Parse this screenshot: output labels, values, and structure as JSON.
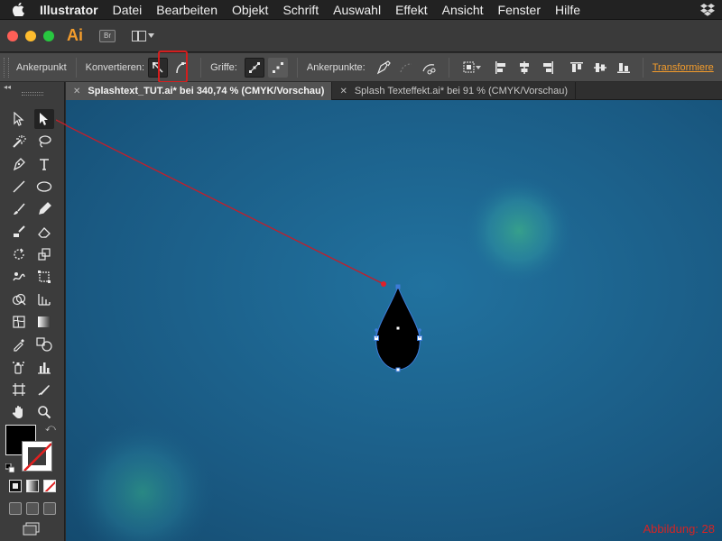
{
  "menubar": {
    "app": "Illustrator",
    "items": [
      "Datei",
      "Bearbeiten",
      "Objekt",
      "Schrift",
      "Auswahl",
      "Effekt",
      "Ansicht",
      "Fenster",
      "Hilfe"
    ]
  },
  "appbar": {
    "logo": "Ai",
    "bridge_label": "Br"
  },
  "controlbar": {
    "context_label": "Ankerpunkt",
    "convert_label": "Konvertieren:",
    "handles_label": "Griffe:",
    "anchors_label": "Ankerpunkte:",
    "transform_link": "Transformiere"
  },
  "tabs": [
    {
      "label": "Splashtext_TUT.ai* bei 340,74 % (CMYK/Vorschau)",
      "active": true
    },
    {
      "label": "Splash Texteffekt.ai* bei 91 % (CMYK/Vorschau)",
      "active": false
    }
  ],
  "figure_label": "Abbildung: 28",
  "colors": {
    "accent": "#f39c2c",
    "annotation": "#d41e1e",
    "canvas": "#1b5a82",
    "close_btn": "#fe5f57",
    "min_btn": "#febc2e",
    "max_btn": "#28c840"
  }
}
